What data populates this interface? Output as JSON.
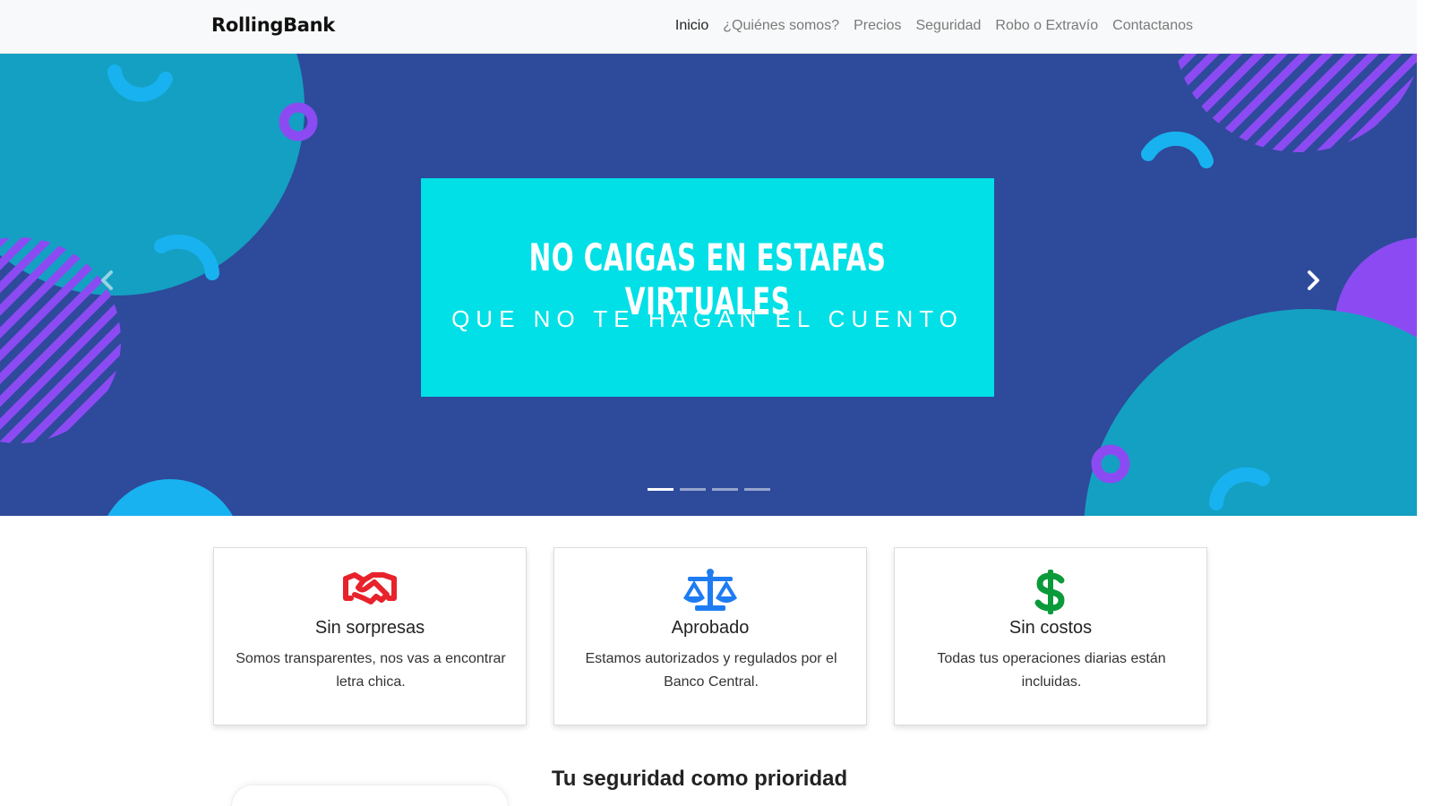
{
  "navbar": {
    "brand": "RollingBank",
    "links": [
      {
        "label": "Inicio",
        "active": true
      },
      {
        "label": "¿Quiénes somos?",
        "active": false
      },
      {
        "label": "Precios",
        "active": false
      },
      {
        "label": "Seguridad",
        "active": false
      },
      {
        "label": "Robo o Extravío",
        "active": false
      },
      {
        "label": "Contactanos",
        "active": false
      }
    ]
  },
  "carousel": {
    "title": "NO CAIGAS EN ESTAFAS VIRTUALES",
    "subtitle": "QUE NO TE HAGAN EL CUENTO",
    "slides_count": 4,
    "active_slide": 1,
    "prev_icon": "chevron-left-icon",
    "next_icon": "chevron-right-icon",
    "colors": {
      "background": "#2e4a9b",
      "banner": "#00e0e6",
      "purple": "#8c4bf2",
      "teal": "#14a0c2",
      "sky": "#18b2f0"
    }
  },
  "features": [
    {
      "icon": "handshake-icon",
      "color": "#e8222b",
      "title": "Sin sorpresas",
      "text": "Somos transparentes, nos vas a encontrar letra chica."
    },
    {
      "icon": "balance-scale-icon",
      "color": "#1e7cf2",
      "title": "Aprobado",
      "text": "Estamos autorizados y regulados por el Banco Central."
    },
    {
      "icon": "dollar-sign-icon",
      "color": "#0a9a3a",
      "title": "Sin costos",
      "text": "Todas tus operaciones diarias están incluidas."
    }
  ],
  "section": {
    "title": "Tu seguridad como prioridad"
  }
}
